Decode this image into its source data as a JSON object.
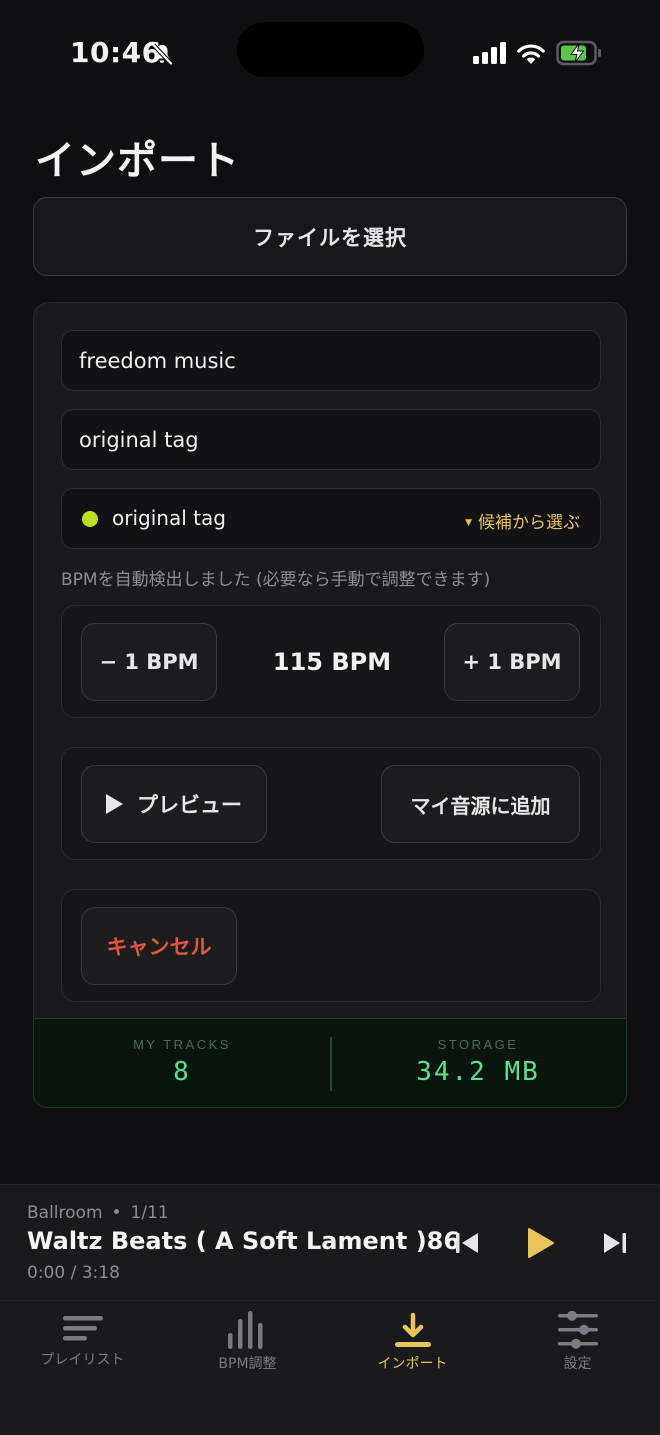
{
  "status": {
    "time": "10:46"
  },
  "page": {
    "title": "インポート"
  },
  "select_file": {
    "label": "ファイルを選択"
  },
  "form": {
    "title_value": "freedom music",
    "tag_value": "original tag",
    "tag_selected": "original tag",
    "tag_suggest_label": "候補から選ぶ",
    "hint": "BPMを自動検出しました (必要なら手動で調整できます)"
  },
  "bpm": {
    "minus_label": "− 1 BPM",
    "value": "115 BPM",
    "plus_label": "+ 1 BPM"
  },
  "actions": {
    "preview_label": "プレビュー",
    "add_label": "マイ音源に追加",
    "cancel_label": "キャンセル"
  },
  "stats": {
    "tracks_label": "MY TRACKS",
    "tracks_value": "8",
    "storage_label": "STORAGE",
    "storage_value": "34.2 MB"
  },
  "player": {
    "playlist": "Ballroom",
    "position": "1/11",
    "title": "Waltz Beats ( A Soft Lament )86",
    "time": "0:00 / 3:18"
  },
  "tabs": [
    {
      "label": "プレイリスト",
      "icon": "list-icon"
    },
    {
      "label": "BPM調整",
      "icon": "bars-icon"
    },
    {
      "label": "インポート",
      "icon": "download-icon",
      "active": true
    },
    {
      "label": "設定",
      "icon": "sliders-icon"
    }
  ],
  "colors": {
    "accent": "#e8c45a",
    "cancel": "#e4553f",
    "tag_dot": "#b5e11f",
    "stat_value": "#5fe08a"
  }
}
